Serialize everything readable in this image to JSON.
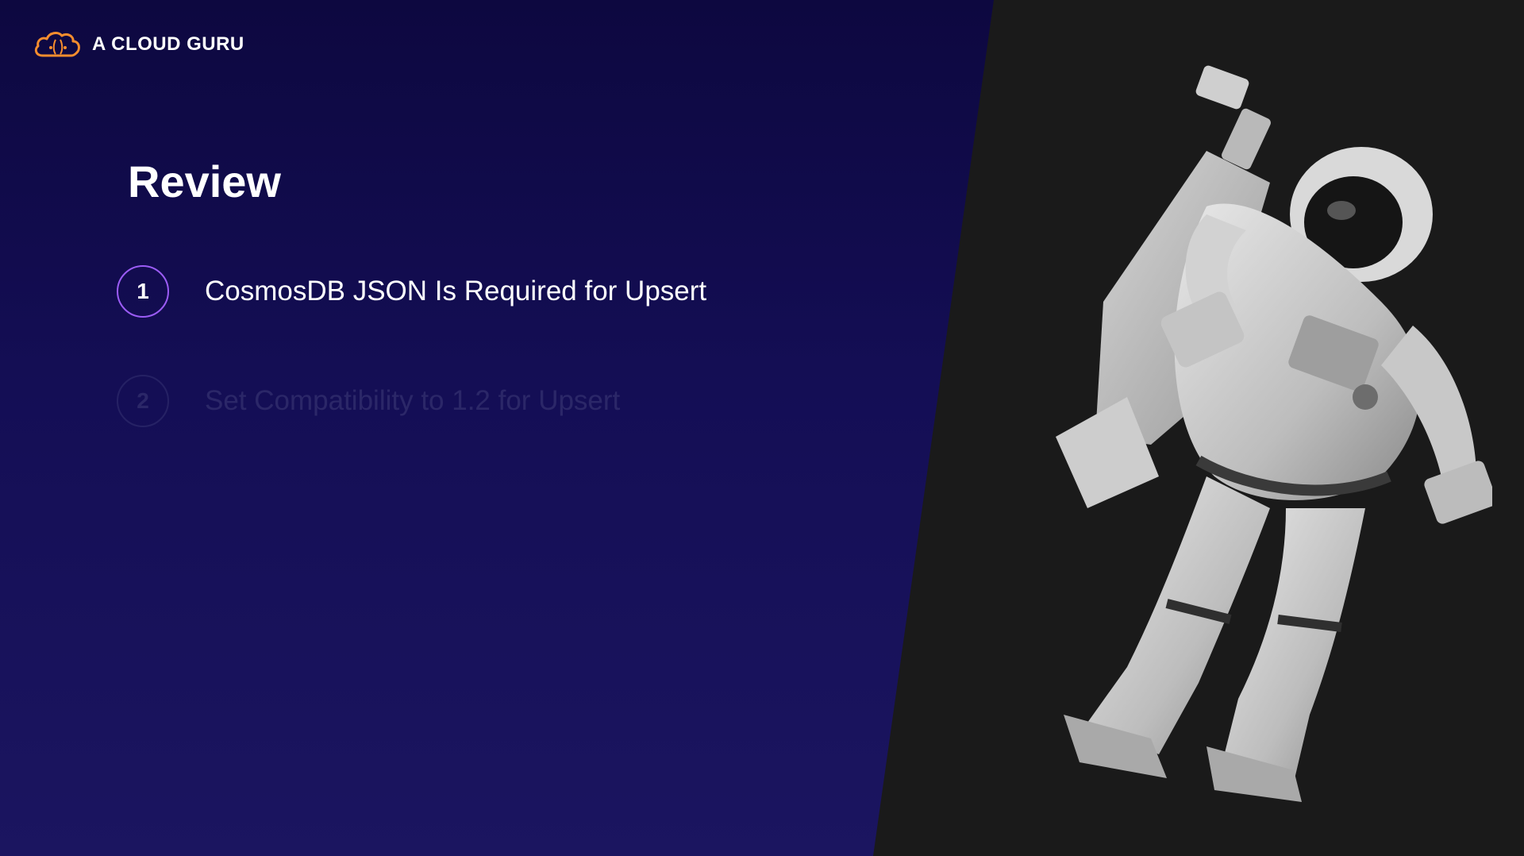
{
  "brand": {
    "logo_text": "A CLOUD GURU",
    "logo_icon": "cloud-icon",
    "accent_color": "#f68d2e"
  },
  "slide": {
    "title": "Review",
    "items": [
      {
        "number": "1",
        "label": "CosmosDB JSON Is Required for Upsert",
        "state": "active"
      },
      {
        "number": "2",
        "label": "Set Compatibility to 1.2 for Upsert",
        "state": "dimmed"
      }
    ],
    "circle_color": "#9b5cf6",
    "background_color": "#140e55"
  },
  "image": {
    "subject": "astronaut-illustration"
  }
}
